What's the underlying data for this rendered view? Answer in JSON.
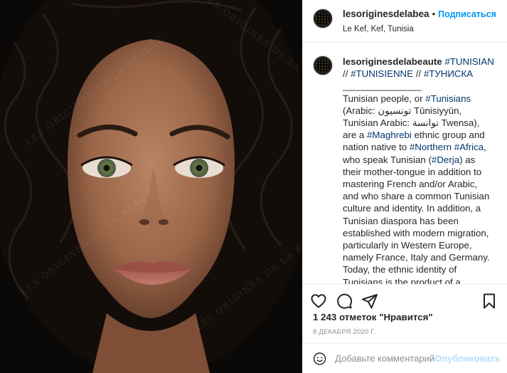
{
  "post": {
    "username": "lesoriginesdelabea",
    "dot": "•",
    "follow_label": "Подписаться",
    "location": "Le Kef, Kef, Tunisia"
  },
  "photo": {
    "watermark_text": "LES ORIGINES DE LA BEAUTE",
    "alt_subject": "portrait-photo"
  },
  "caption": {
    "author": "lesoriginesdelabeaute",
    "tag_tunisian": "#TUNISIAN",
    "slash1": " // ",
    "tag_tunisienne": "#TUNISIENNE",
    "slash2": " // ",
    "tag_tuniska": "#ТУНИСКА",
    "separator": "_______________",
    "p1_a": "Tunisian people, or ",
    "tag_tunisians": "#Tunisians",
    "p1_b": " (Arabic: تونسيون Tūnisiyyūn, Tunisian Arabic: توانسة Twensa), are a ",
    "tag_maghrebi": "#Maghrebi",
    "p1_c": " ethnic group and nation native to ",
    "tag_northern": "#Northern",
    "p1_space": " ",
    "tag_africa": "#Africa",
    "p1_d": ", who speak Tunisian (",
    "tag_derja": "#Derja",
    "p1_e": ") as their mother-tongue in addition to mastering French and/or Arabic, and who share a common Tunisian culture and identity. In addition, a Tunisian diaspora has been established with modern migration, particularly in Western Europe, namely France, Italy and Germany.",
    "p2": "Today, the ethnic identity of Tunisians is the product of a centuries-long historical trajectory, with the Tunisian"
  },
  "stats": {
    "likes": "1 243 отметок \"Нравится\"",
    "date": "8 ДЕКАБРЯ 2020 Г."
  },
  "comment": {
    "placeholder": "Добавьте комментарий...",
    "publish_label": "Опубликовать"
  },
  "icons": [
    "heart-icon",
    "comment-icon",
    "share-icon",
    "save-icon",
    "emoji-icon"
  ],
  "colors": {
    "link": "#00376b",
    "follow": "#0095f6",
    "publish_disabled": "#b2dffc",
    "muted": "#8e8e8e"
  }
}
